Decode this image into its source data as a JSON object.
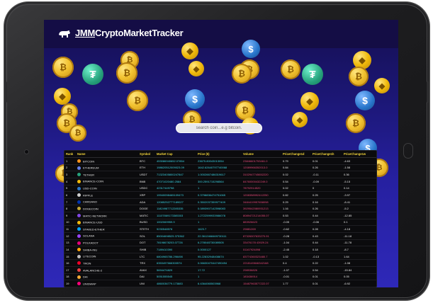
{
  "app": {
    "brand_prefix": "JMM",
    "brand_rest": "CryptoMarketTracker"
  },
  "search": {
    "placeholder": "search coin...e.g bitcoin."
  },
  "table": {
    "columns": [
      "Rank",
      "Name",
      "Symbol",
      "Market Cap",
      "Price ($)",
      "Volume",
      "PriceChange1d",
      "PriceChange1h",
      "PriceChange1w"
    ],
    "rows": [
      {
        "rank": "1",
        "name": "BITCOIN",
        "symbol": "BTC",
        "cap": "453086940652.07854",
        "price": "23675.80043013054",
        "volume": "23846601753461.0",
        "d": "0.79",
        "h": "0.01",
        "w": "-4.63",
        "icon": "#f7931a"
      },
      {
        "rank": "2",
        "name": "ETHEREUM",
        "symbol": "ETH",
        "cap": "198620512009023.09",
        "price": "1642.62640797740068",
        "volume": "12089966352013.0",
        "d": "0.84",
        "h": "0.26",
        "w": "-1.58",
        "icon": "#627eea"
      },
      {
        "rank": "3",
        "name": "TETHER",
        "symbol": "USDT",
        "cap": "71323405800247847",
        "price": "1.0002667486319617",
        "volume": "3102947745652220",
        "d": "0.02",
        "h": "-0.11",
        "w": "0.36",
        "icon": "#26a17b"
      },
      {
        "rank": "4",
        "name": "BINANCE-COIN",
        "symbol": "BNB",
        "cap": "47071020480.2584",
        "price": "300.2591715298564",
        "volume": "84760000432249.0",
        "d": "0.54",
        "h": "-0.09",
        "w": "-5.15",
        "icon": "#f0b90b"
      },
      {
        "rank": "5",
        "name": "USD-COIN",
        "symbol": "USDC",
        "cap": "42317449798",
        "price": "1",
        "volume": "78792914520",
        "d": "0.02",
        "h": "0",
        "w": "0.14",
        "icon": "#2775ca"
      },
      {
        "rank": "6",
        "name": "RIPPLE",
        "symbol": "XRP",
        "cap": "19940098465109473",
        "price": "0.3798836474751065",
        "volume": "1208358992412250",
        "d": "0.82",
        "h": "0.25",
        "w": "-3.97",
        "icon": "#cfcfcf"
      },
      {
        "rank": "7",
        "name": "CARDANO",
        "symbol": "ADA",
        "cap": "12085252777189027",
        "price": "0.3502037359977409",
        "volume": "3484419957658098",
        "d": "0.29",
        "h": "0.16",
        "w": "-8.41",
        "icon": "#0033ad"
      },
      {
        "rank": "8",
        "name": "DOGECOIN",
        "symbol": "DOGE",
        "cap": "11824987712285335",
        "price": "0.0893907142598083",
        "volume": "3929542080931213",
        "d": "1.16",
        "h": "0.26",
        "w": "-5.2",
        "icon": "#c2a633"
      },
      {
        "rank": "9",
        "name": "MATIC-NETWORK",
        "symbol": "MATIC",
        "cap": "11107869173385303",
        "price": "1.2722599933986078",
        "volume": "80894721214055.07",
        "d": "0.53",
        "h": "0.44",
        "w": "-12.85",
        "icon": "#8247e5"
      },
      {
        "rank": "10",
        "name": "BINANCE-USD",
        "symbol": "BUSD",
        "cap": "1002069959.9",
        "price": "1",
        "volume": "883926623",
        "d": "-0.05",
        "h": "-0.06",
        "w": "0.1",
        "icon": "#f0b90b"
      },
      {
        "rank": "11",
        "name": "STAKED-ETHER",
        "symbol": "STETH",
        "cap": "9230548578",
        "price": "1623.7",
        "volume": "29881269",
        "d": "-0.62",
        "h": "0.28",
        "w": "-4.18",
        "icon": "#00a3ff"
      },
      {
        "rank": "12",
        "name": "SOLANA",
        "symbol": "SOL",
        "cap": "85004698525.375362",
        "price": "22.3612468469730111",
        "volume": "87326007633270.91",
        "d": "-0.28",
        "h": "0.43",
        "w": "-11.18",
        "icon": "#9945ff"
      },
      {
        "rank": "13",
        "name": "POLKADOT",
        "symbol": "DOT",
        "cap": "78198678203.07726",
        "price": "6.278048730089505",
        "volume": "33476178 43929.24",
        "d": "-1.04",
        "h": "0.44",
        "w": "-11.78",
        "icon": "#e6007a"
      },
      {
        "rank": "14",
        "name": "SHIBA-INU",
        "symbol": "SHIB",
        "cap": "7189410390",
        "price": "0.0000127",
        "volume": "51167924898",
        "d": "-2.45",
        "h": "0.18",
        "w": "-8.7",
        "icon": "#ffa409"
      },
      {
        "rank": "15",
        "name": "LITECOIN",
        "symbol": "LTC",
        "cap": "6804965786.298498",
        "price": "95.22832948408674",
        "volume": "83774360323480.7",
        "d": "1.02",
        "h": "-0.13",
        "w": "1.64",
        "icon": "#bfbbbb"
      },
      {
        "rank": "16",
        "name": "TRON",
        "symbol": "TRX",
        "cap": "6353497666300574",
        "price": "0.06630470447490494",
        "volume": "2218149846342168",
        "d": "0.4",
        "h": "0.22",
        "w": "-1.08",
        "icon": "#ef0027"
      },
      {
        "rank": "17",
        "name": "AVALANCHE-2",
        "symbol": "AVAX",
        "cap": "5694474829",
        "price": "17.72",
        "volume": "298936826",
        "d": "-1.07",
        "h": "0.54",
        "w": "-15.84",
        "icon": "#e84142"
      },
      {
        "rank": "18",
        "name": "DAI",
        "symbol": "DAI",
        "cap": "5051555545",
        "price": "1",
        "volume": "183436914",
        "d": "-0.01",
        "h": "0.01",
        "w": "0.05",
        "icon": "#f5ac37"
      },
      {
        "rank": "19",
        "name": "UNISWAP",
        "symbol": "UNI",
        "cap": "4860036779.173883",
        "price": "6.4364065503968",
        "volume": "15487963577222.07",
        "d": "1.77",
        "h": "0.01",
        "w": "-6.92",
        "icon": "#ff007a"
      },
      {
        "rank": "20",
        "name": "WRAPPED-BITCOIN",
        "symbol": "WBTC",
        "cap": "3818477362",
        "price": "23590",
        "volume": "85318614",
        "d": "-0.27",
        "h": "0.3",
        "w": "-5.66",
        "icon": "#f09242"
      }
    ]
  }
}
